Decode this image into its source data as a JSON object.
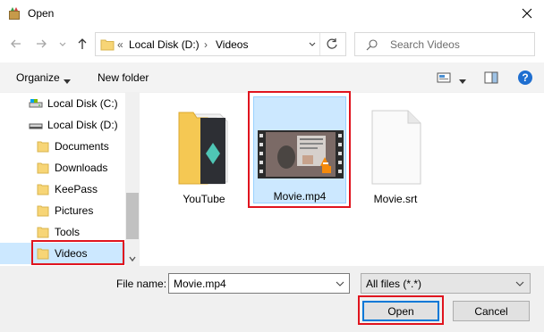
{
  "window": {
    "title": "Open"
  },
  "address": {
    "prefix": "«",
    "crumbs": [
      "Local Disk (D:)",
      "Videos"
    ],
    "separator": "›"
  },
  "search": {
    "placeholder": "Search Videos"
  },
  "toolbar": {
    "organize_label": "Organize",
    "new_folder_label": "New folder",
    "help_label": "?"
  },
  "nav": {
    "items": [
      {
        "label": "Local Disk (C:)",
        "icon": "drive-icon"
      },
      {
        "label": "Local Disk (D:)",
        "icon": "drive-icon"
      },
      {
        "label": "Documents",
        "icon": "folder-icon"
      },
      {
        "label": "Downloads",
        "icon": "folder-icon"
      },
      {
        "label": "KeePass",
        "icon": "folder-icon"
      },
      {
        "label": "Pictures",
        "icon": "folder-icon"
      },
      {
        "label": "Tools",
        "icon": "folder-icon"
      },
      {
        "label": "Videos",
        "icon": "folder-icon",
        "selected": true
      }
    ]
  },
  "files": [
    {
      "name": "YouTube",
      "type": "folder"
    },
    {
      "name": "Movie.mp4",
      "type": "video",
      "selected": true
    },
    {
      "name": "Movie.srt",
      "type": "text"
    }
  ],
  "bottom": {
    "file_name_label": "File name:",
    "file_name_value": "Movie.mp4",
    "filter_value": "All files (*.*)",
    "open_label": "Open",
    "cancel_label": "Cancel"
  },
  "colors": {
    "selection": "#cce8ff",
    "highlight": "#e0141e",
    "accent": "#0078d7"
  }
}
